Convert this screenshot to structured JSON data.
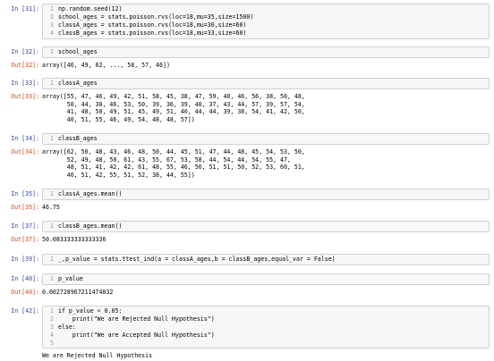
{
  "cells": [
    {
      "in_prompt": "In [31]:",
      "lines": [
        {
          "n": "1",
          "text": "np.random.seed(12)"
        },
        {
          "n": "2",
          "text": "school_ages = stats.poisson.rvs(loc=18,mu=35,size=1500)"
        },
        {
          "n": "3",
          "text": "classA_ages = stats.poisson.rvs(loc=18,mu=30,size=60)"
        },
        {
          "n": "4",
          "text": "classB_ages = stats.poisson.rvs(loc=18,mu=33,size=60)"
        }
      ]
    },
    {
      "in_prompt": "In [32]:",
      "lines": [
        {
          "n": "1",
          "text": "school_ages"
        }
      ],
      "out_prompt": "Out[32]:",
      "output": "array([46, 49, 62, ..., 58, 57, 46])"
    },
    {
      "in_prompt": "In [33]:",
      "lines": [
        {
          "n": "1",
          "text": "classA_ages"
        }
      ],
      "out_prompt": "Out[33]:",
      "output": "array([55, 47, 46, 49, 42, 51, 58, 45, 38, 47, 59, 40, 46, 56, 38, 50, 48,\n       50, 44, 38, 46, 53, 50, 39, 36, 39, 40, 37, 43, 44, 57, 39, 57, 54,\n       41, 48, 50, 49, 51, 45, 49, 51, 40, 44, 44, 39, 38, 54, 41, 42, 50,\n       40, 51, 55, 46, 49, 54, 48, 48, 57])"
    },
    {
      "in_prompt": "In [34]:",
      "lines": [
        {
          "n": "1",
          "text": "classB_ages"
        }
      ],
      "out_prompt": "Out[34]:",
      "output": "array([62, 50, 48, 43, 46, 48, 50, 44, 45, 51, 47, 44, 48, 45, 54, 53, 50,\n       52, 49, 48, 50, 61, 43, 55, 67, 53, 58, 44, 54, 44, 54, 55, 47,\n       48, 51, 41, 42, 42, 61, 48, 55, 46, 56, 51, 51, 50, 52, 53, 60, 51,\n       46, 51, 42, 55, 51, 52, 38, 44, 55])"
    },
    {
      "in_prompt": "In [35]:",
      "lines": [
        {
          "n": "1",
          "text": "classA_ages.mean()"
        }
      ],
      "out_prompt": "Out[35]:",
      "output": "46.75"
    },
    {
      "in_prompt": "In [37]:",
      "lines": [
        {
          "n": "1",
          "text": "classB_ages.mean()"
        }
      ],
      "out_prompt": "Out[37]:",
      "output": "50.083333333333336"
    },
    {
      "in_prompt": "In [39]:",
      "lines": [
        {
          "n": "1",
          "text": "_,p_value = stats.ttest_ind(a = classA_ages,b = classB_ages,equal_var = False)"
        }
      ]
    },
    {
      "in_prompt": "In [40]:",
      "lines": [
        {
          "n": "1",
          "text": "p_value"
        }
      ],
      "out_prompt": "Out[40]:",
      "output": "0.002728967211474832"
    },
    {
      "in_prompt": "In [42]:",
      "lines": [
        {
          "n": "1",
          "text": "if p_value < 0.05:"
        },
        {
          "n": "2",
          "text": "    print(\"We are Rejected Null Hypothesis\")"
        },
        {
          "n": "3",
          "text": "else:"
        },
        {
          "n": "4",
          "text": "    print(\"We are Accepted Null Hypothesis\")"
        },
        {
          "n": "5",
          "text": ""
        }
      ],
      "output": "We are Rejected Null Hypothesis"
    }
  ]
}
